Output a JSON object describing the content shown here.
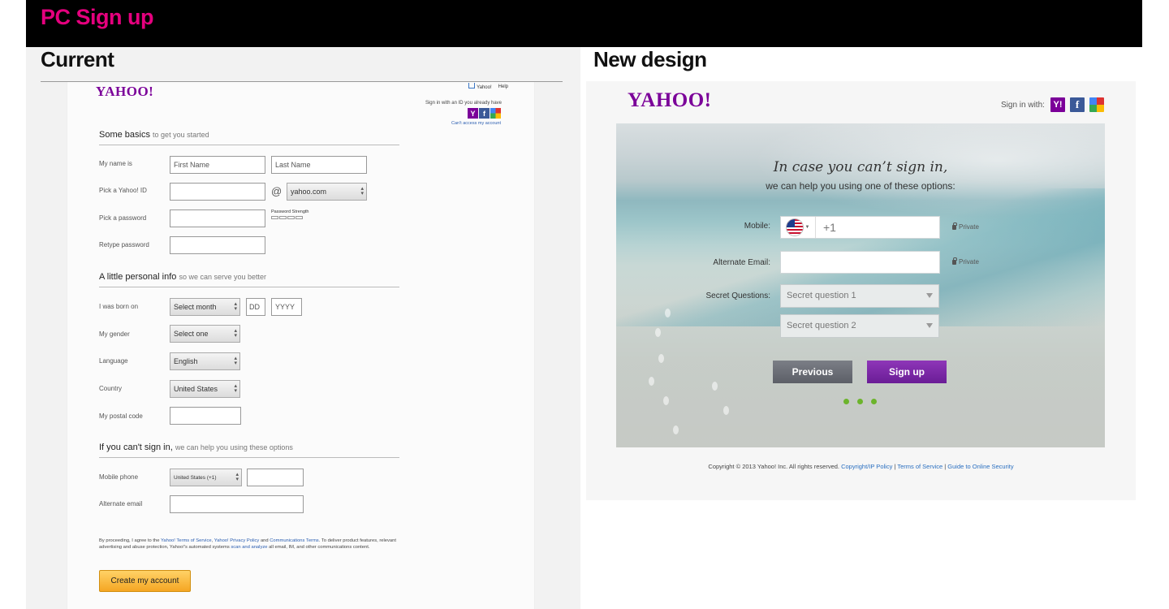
{
  "banner": {
    "title": "PC Sign up"
  },
  "current": {
    "heading": "Current",
    "logo": "YAHOO!",
    "toplinks": {
      "home": "Yahoo!",
      "help": "Help"
    },
    "signin_text": "Sign in with an ID you already have",
    "cant_access": "Can't access my account",
    "basics": {
      "title": "Some basics",
      "subtitle": "to get you started"
    },
    "labels": {
      "name": "My name is",
      "yahoo_id": "Pick a Yahoo! ID",
      "password": "Pick a password",
      "retype": "Retype password",
      "born": "I was born on",
      "gender": "My gender",
      "language": "Language",
      "country": "Country",
      "postal": "My postal code",
      "mobile": "Mobile phone",
      "alt_email": "Alternate email"
    },
    "placeholders": {
      "first": "First Name",
      "last": "Last Name",
      "dd": "DD",
      "yyyy": "YYYY"
    },
    "domain": "yahoo.com",
    "at": "@",
    "password_strength": "Password Strength",
    "personal": {
      "title": "A little personal info",
      "subtitle": "so we can serve you better"
    },
    "selects": {
      "month": "Select month",
      "gender": "Select one",
      "language": "English",
      "country": "United States",
      "mobile_country": "United States (+1)"
    },
    "cant_signin": {
      "title": "If you can't sign in,",
      "subtitle": "we can help you using these options"
    },
    "legal": {
      "p1": "By proceeding, I agree to the ",
      "l1": "Yahoo! Terms of Service",
      "p2": ", ",
      "l2": "Yahoo! Privacy Policy",
      "p3": " and ",
      "l3": "Communications Terms",
      "p4": ". To deliver product features, relevant advertising and abuse protection, Yahoo!'s automated systems ",
      "l4": "scan and analyze",
      "p5": " all email, IM, and other communications content."
    },
    "create_button": "Create my account"
  },
  "newdesign": {
    "heading": "New design",
    "logo": "YAHOO!",
    "signin_with": "Sign in with:",
    "title": "In case you can’t sign in,",
    "subtitle": "we can help you using one of these options:",
    "mobile_label": "Mobile:",
    "phone_code": "+1",
    "private": "Private",
    "alt_email_label": "Alternate Email:",
    "secret_label": "Secret Questions:",
    "secret1": "Secret question 1",
    "secret2": "Secret question 2",
    "previous": "Previous",
    "signup": "Sign up",
    "copyright": "Copyright © 2013 Yahoo! Inc. All rights reserved.",
    "links": [
      "Copyright/IP Policy",
      "Terms of Service",
      "Guide to Online Security"
    ],
    "separator": " | ",
    "dot_color": "#6cb42c"
  }
}
